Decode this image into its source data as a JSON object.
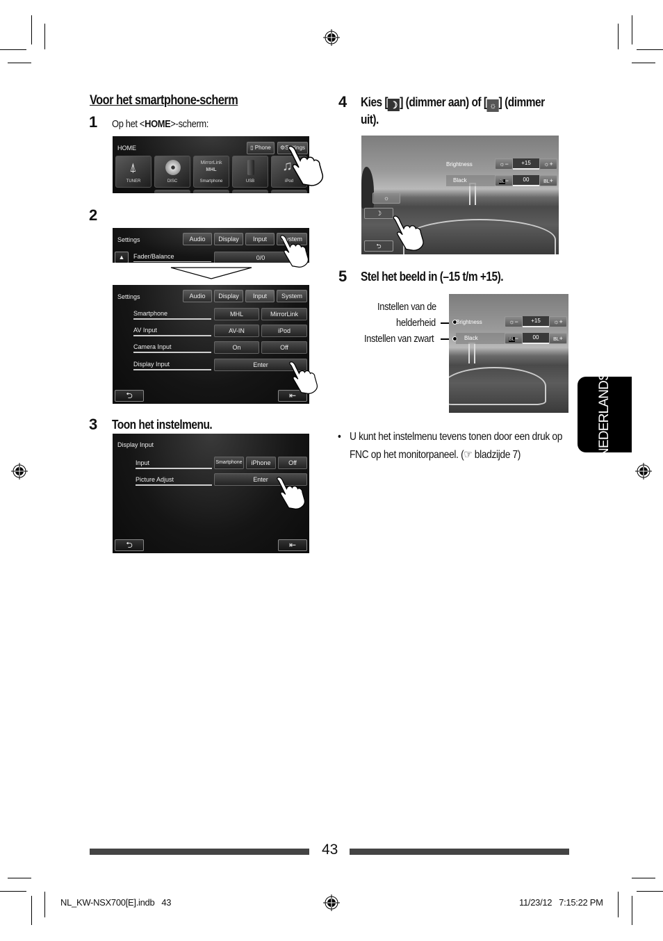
{
  "section_title": "Voor het smartphone-scherm",
  "steps": [
    {
      "number": "1",
      "text_prefix": "Op het <",
      "text_bold": "HOME",
      "text_suffix": ">-scherm:",
      "screen": {
        "title": "HOME",
        "top_buttons": [
          "Phone",
          "Settings"
        ],
        "tiles": [
          {
            "label": "TUNER",
            "icon": "antenna-tower-icon"
          },
          {
            "label": "DISC",
            "icon": "disc-icon"
          },
          {
            "label": "Smartphone",
            "icon": "mirrorlink-mhl-icon",
            "logo_top": "MirrorLink",
            "logo_bottom": "MHL"
          },
          {
            "label": "USB",
            "icon": "usb-stick-icon"
          },
          {
            "label": "iPod",
            "icon": "music-note-icon"
          }
        ]
      }
    },
    {
      "number": "2",
      "screen_a": {
        "title": "Settings",
        "tabs": [
          "Audio",
          "Display",
          "Input",
          "System"
        ],
        "rows": [
          {
            "label": "Fader/Balance",
            "value": "0/0"
          }
        ]
      },
      "screen_b": {
        "title": "Settings",
        "tabs": [
          "Audio",
          "Display",
          "Input",
          "System"
        ],
        "selected_tab": "Input",
        "rows": [
          {
            "label": "Smartphone",
            "options": [
              "MHL",
              "MirrorLink"
            ]
          },
          {
            "label": "AV Input",
            "options": [
              "AV-IN",
              "iPod"
            ]
          },
          {
            "label": "Camera Input",
            "options": [
              "On",
              "Off"
            ]
          },
          {
            "label": "Display Input",
            "options": [
              "Enter"
            ]
          }
        ]
      }
    },
    {
      "number": "3",
      "text": "Toon het instelmenu.",
      "screen": {
        "title": "Display Input",
        "rows": [
          {
            "label": "Input",
            "options": [
              "Smartphone",
              "iPhone",
              "Off"
            ]
          },
          {
            "label": "Picture Adjust",
            "options": [
              "Enter"
            ]
          }
        ]
      }
    },
    {
      "number": "4",
      "text_parts": [
        "Kies [",
        "] (dimmer aan) of [",
        "] (dimmer",
        "uit)."
      ],
      "icons": [
        "moon-icon",
        "sun-icon"
      ],
      "screen": {
        "brightness_label": "Brightness",
        "brightness_value": "+15",
        "black_label": "Black",
        "black_value": "00",
        "bl_glyph": "BL"
      }
    },
    {
      "number": "5",
      "text": "Stel het beeld in (–15 t/m +15).",
      "callouts": {
        "brightness_line1": "Instellen van de",
        "brightness_line2": "helderheid",
        "black": "Instellen van zwart"
      },
      "screen": {
        "brightness_label": "Brightness",
        "brightness_value": "+15",
        "black_label": "Black",
        "black_value": "00",
        "bl_glyph": "BL"
      }
    }
  ],
  "note": {
    "bullet": "•",
    "line1": "U kunt het instelmenu tevens tonen door een druk op",
    "line2_prefix": "FNC op het monitorpaneel. (",
    "ref_icon": "☞",
    "line2_suffix": " bladzijde 7)"
  },
  "language_tab": "NEDERLANDS",
  "page_number": "43",
  "footer": {
    "file": "NL_KW-NSX700[E].indb   43",
    "timestamp": "11/23/12   7:15:22 PM"
  }
}
